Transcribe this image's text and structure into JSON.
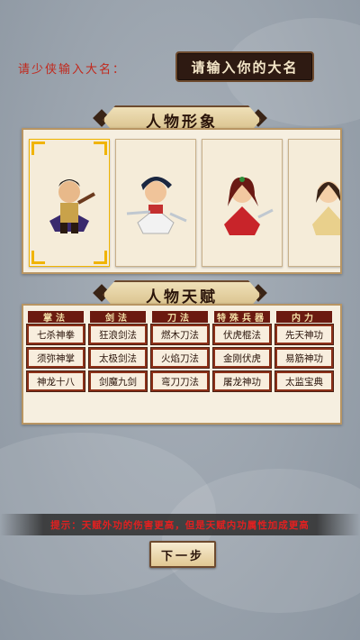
{
  "name_prompt": {
    "label": "请少侠输入大名：",
    "placeholder": "请输入你的大名"
  },
  "appearance": {
    "title": "人物形象"
  },
  "talent": {
    "title": "人物天赋",
    "headers": [
      "掌法",
      "剑法",
      "刀法",
      "特殊兵器",
      "内力"
    ],
    "rows": [
      [
        "七杀神拳",
        "狂浪剑法",
        "燃木刀法",
        "伏虎棍法",
        "先天神功"
      ],
      [
        "须弥神掌",
        "太极剑法",
        "火焰刀法",
        "金刚伏虎",
        "易筋神功"
      ],
      [
        "神龙十八",
        "剑魔九剑",
        "弯刀刀法",
        "屠龙神功",
        "太监宝典"
      ]
    ]
  },
  "tip": "提示：天赋外功的伤害更高，但是天赋内功属性加成更高",
  "next_button": "下一步"
}
